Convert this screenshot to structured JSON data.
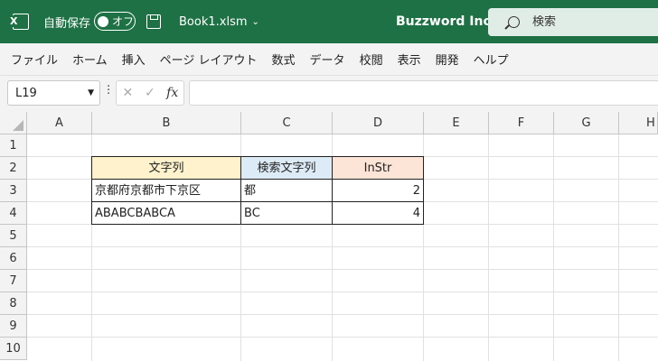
{
  "titlebar": {
    "autosave_label": "自動保存",
    "toggle_state": "オフ",
    "filename": "Book1.xlsm",
    "company": "Buzzword Inc.",
    "search_placeholder": "検索"
  },
  "menu": [
    "ファイル",
    "ホーム",
    "挿入",
    "ページ レイアウト",
    "数式",
    "データ",
    "校閲",
    "表示",
    "開発",
    "ヘルプ"
  ],
  "formula_bar": {
    "name_box": "L19",
    "formula": ""
  },
  "columns": [
    "A",
    "B",
    "C",
    "D",
    "E",
    "F",
    "G",
    "H"
  ],
  "rows": [
    "1",
    "2",
    "3",
    "4",
    "5",
    "6",
    "7",
    "8",
    "9",
    "10"
  ],
  "table": {
    "headers": [
      "文字列",
      "検索文字列",
      "InStr"
    ],
    "header_colors": [
      "#fff2cc",
      "#ddebf7",
      "#fce4d6"
    ],
    "rows": [
      [
        "京都府京都市下京区",
        "都",
        "2"
      ],
      [
        "ABABCBABCA",
        "BC",
        "4"
      ]
    ]
  },
  "colors": {
    "ribbon_green": "#1e7145"
  }
}
